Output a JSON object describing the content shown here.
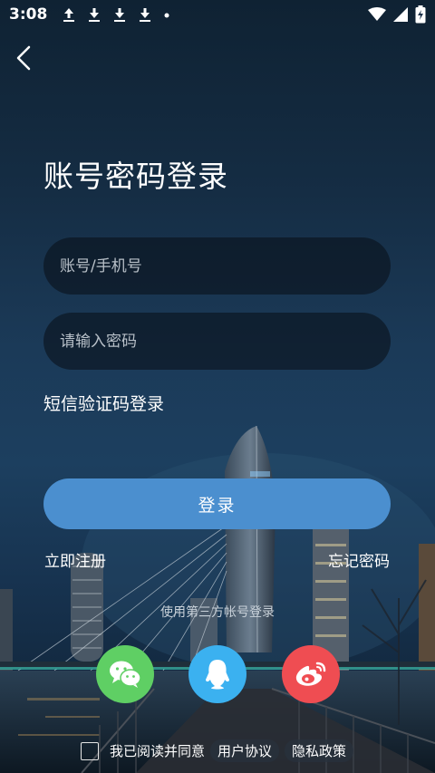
{
  "status_bar": {
    "time": "3:08"
  },
  "title": "账号密码登录",
  "account_input": {
    "placeholder": "账号/手机号",
    "value": ""
  },
  "password_input": {
    "placeholder": "请输入密码",
    "value": ""
  },
  "sms_login_label": "短信验证码登录",
  "login_button_label": "登录",
  "register_label": "立即注册",
  "forgot_password_label": "忘记密码",
  "third_party_label": "使用第三方帐号登录",
  "social": [
    {
      "name": "wechat",
      "icon": "wechat-icon",
      "color": "#5fcf64"
    },
    {
      "name": "qq",
      "icon": "qq-icon",
      "color": "#3bb1f0"
    },
    {
      "name": "weibo",
      "icon": "weibo-icon",
      "color": "#ef4d52"
    }
  ],
  "agreement": {
    "checked": false,
    "text": "我已阅读并同意",
    "user_agreement": "用户协议",
    "privacy_policy": "隐私政策"
  },
  "accent_color": "#4b8fcf"
}
